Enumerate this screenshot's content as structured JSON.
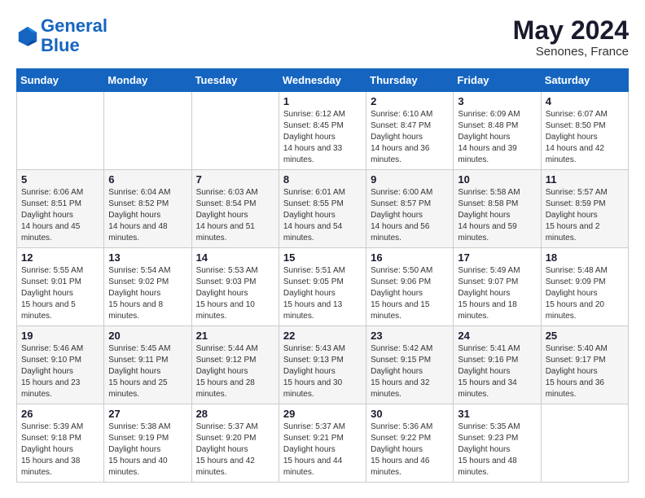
{
  "header": {
    "logo_line1": "General",
    "logo_line2": "Blue",
    "month_year": "May 2024",
    "location": "Senones, France"
  },
  "weekdays": [
    "Sunday",
    "Monday",
    "Tuesday",
    "Wednesday",
    "Thursday",
    "Friday",
    "Saturday"
  ],
  "weeks": [
    [
      null,
      null,
      null,
      {
        "day": "1",
        "sunrise": "6:12 AM",
        "sunset": "8:45 PM",
        "daylight": "14 hours and 33 minutes."
      },
      {
        "day": "2",
        "sunrise": "6:10 AM",
        "sunset": "8:47 PM",
        "daylight": "14 hours and 36 minutes."
      },
      {
        "day": "3",
        "sunrise": "6:09 AM",
        "sunset": "8:48 PM",
        "daylight": "14 hours and 39 minutes."
      },
      {
        "day": "4",
        "sunrise": "6:07 AM",
        "sunset": "8:50 PM",
        "daylight": "14 hours and 42 minutes."
      }
    ],
    [
      {
        "day": "5",
        "sunrise": "6:06 AM",
        "sunset": "8:51 PM",
        "daylight": "14 hours and 45 minutes."
      },
      {
        "day": "6",
        "sunrise": "6:04 AM",
        "sunset": "8:52 PM",
        "daylight": "14 hours and 48 minutes."
      },
      {
        "day": "7",
        "sunrise": "6:03 AM",
        "sunset": "8:54 PM",
        "daylight": "14 hours and 51 minutes."
      },
      {
        "day": "8",
        "sunrise": "6:01 AM",
        "sunset": "8:55 PM",
        "daylight": "14 hours and 54 minutes."
      },
      {
        "day": "9",
        "sunrise": "6:00 AM",
        "sunset": "8:57 PM",
        "daylight": "14 hours and 56 minutes."
      },
      {
        "day": "10",
        "sunrise": "5:58 AM",
        "sunset": "8:58 PM",
        "daylight": "14 hours and 59 minutes."
      },
      {
        "day": "11",
        "sunrise": "5:57 AM",
        "sunset": "8:59 PM",
        "daylight": "15 hours and 2 minutes."
      }
    ],
    [
      {
        "day": "12",
        "sunrise": "5:55 AM",
        "sunset": "9:01 PM",
        "daylight": "15 hours and 5 minutes."
      },
      {
        "day": "13",
        "sunrise": "5:54 AM",
        "sunset": "9:02 PM",
        "daylight": "15 hours and 8 minutes."
      },
      {
        "day": "14",
        "sunrise": "5:53 AM",
        "sunset": "9:03 PM",
        "daylight": "15 hours and 10 minutes."
      },
      {
        "day": "15",
        "sunrise": "5:51 AM",
        "sunset": "9:05 PM",
        "daylight": "15 hours and 13 minutes."
      },
      {
        "day": "16",
        "sunrise": "5:50 AM",
        "sunset": "9:06 PM",
        "daylight": "15 hours and 15 minutes."
      },
      {
        "day": "17",
        "sunrise": "5:49 AM",
        "sunset": "9:07 PM",
        "daylight": "15 hours and 18 minutes."
      },
      {
        "day": "18",
        "sunrise": "5:48 AM",
        "sunset": "9:09 PM",
        "daylight": "15 hours and 20 minutes."
      }
    ],
    [
      {
        "day": "19",
        "sunrise": "5:46 AM",
        "sunset": "9:10 PM",
        "daylight": "15 hours and 23 minutes."
      },
      {
        "day": "20",
        "sunrise": "5:45 AM",
        "sunset": "9:11 PM",
        "daylight": "15 hours and 25 minutes."
      },
      {
        "day": "21",
        "sunrise": "5:44 AM",
        "sunset": "9:12 PM",
        "daylight": "15 hours and 28 minutes."
      },
      {
        "day": "22",
        "sunrise": "5:43 AM",
        "sunset": "9:13 PM",
        "daylight": "15 hours and 30 minutes."
      },
      {
        "day": "23",
        "sunrise": "5:42 AM",
        "sunset": "9:15 PM",
        "daylight": "15 hours and 32 minutes."
      },
      {
        "day": "24",
        "sunrise": "5:41 AM",
        "sunset": "9:16 PM",
        "daylight": "15 hours and 34 minutes."
      },
      {
        "day": "25",
        "sunrise": "5:40 AM",
        "sunset": "9:17 PM",
        "daylight": "15 hours and 36 minutes."
      }
    ],
    [
      {
        "day": "26",
        "sunrise": "5:39 AM",
        "sunset": "9:18 PM",
        "daylight": "15 hours and 38 minutes."
      },
      {
        "day": "27",
        "sunrise": "5:38 AM",
        "sunset": "9:19 PM",
        "daylight": "15 hours and 40 minutes."
      },
      {
        "day": "28",
        "sunrise": "5:37 AM",
        "sunset": "9:20 PM",
        "daylight": "15 hours and 42 minutes."
      },
      {
        "day": "29",
        "sunrise": "5:37 AM",
        "sunset": "9:21 PM",
        "daylight": "15 hours and 44 minutes."
      },
      {
        "day": "30",
        "sunrise": "5:36 AM",
        "sunset": "9:22 PM",
        "daylight": "15 hours and 46 minutes."
      },
      {
        "day": "31",
        "sunrise": "5:35 AM",
        "sunset": "9:23 PM",
        "daylight": "15 hours and 48 minutes."
      },
      null
    ]
  ]
}
